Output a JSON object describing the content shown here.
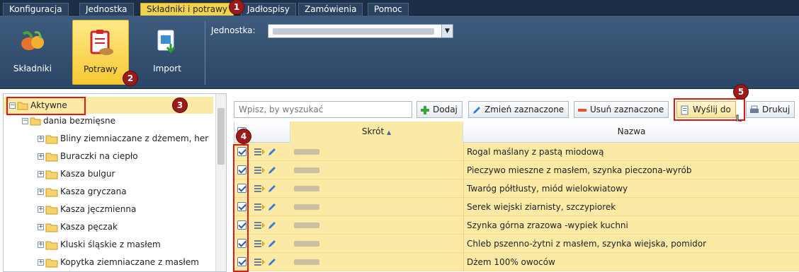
{
  "menu": {
    "tabs": [
      "Konfiguracja",
      "Jednostka",
      "Składniki i potrawy",
      "Jadłospisy",
      "Zamówienia",
      "Pomoc"
    ],
    "active_tab": "Składniki i potrawy"
  },
  "ribbon": {
    "buttons": [
      "Składniki",
      "Potrawy",
      "Import"
    ],
    "active": "Potrawy",
    "jednostka_label": "Jednostka:"
  },
  "badges": [
    "1",
    "2",
    "3",
    "4",
    "5"
  ],
  "tree": {
    "root": "Aktywne",
    "group": "dania bezmięsne",
    "items": [
      "Bliny ziemniaczane z dżemem, her",
      "Buraczki na ciepło",
      "Kasza bulgur",
      "Kasza gryczana",
      "Kasza jęczmienna",
      "Kasza pęczak",
      "Kluski śląskie z masłem",
      "Kopytka ziemniaczane z masłem"
    ]
  },
  "toolbar": {
    "search_placeholder": "Wpisz, by wyszukać",
    "add": "Dodaj",
    "change": "Zmień zaznaczone",
    "delete": "Usuń zaznaczone",
    "send": "Wyślij do",
    "print": "Drukuj"
  },
  "grid": {
    "col_short": "Skrót",
    "col_name": "Nazwa",
    "rows": [
      "Rogal maślany z pastą miodową",
      "Pieczywo mieszne z masłem, szynka pieczona-wyrób",
      "Twaróg półtłusty, miód wielokwiatowy",
      "Serek wiejski ziarnisty, szczypiorek",
      "Szynka górna zrazowa -wypiek kuchni",
      "Chleb pszenno-żytni z masłem, szynka wiejska, pomidor",
      "Dżem 100% owoców"
    ]
  },
  "colors": {
    "accent": "#f1d24c",
    "highlight_row": "#fbe9a6",
    "ribbon": "#34506f",
    "marker": "#e01818"
  }
}
